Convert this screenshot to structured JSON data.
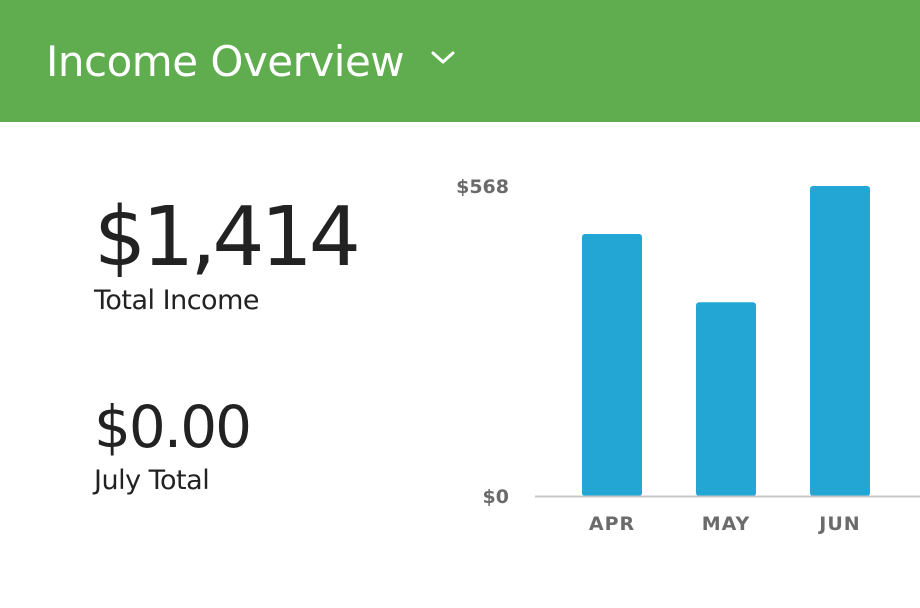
{
  "header": {
    "title": "Income Overview"
  },
  "stats": {
    "total_value": "$1,414",
    "total_label": "Total Income",
    "month_value": "$0.00",
    "month_label": "July Total"
  },
  "colors": {
    "header_bg": "#5fad4e",
    "bar": "#24a6d4",
    "axis": "#c8c8c8",
    "axis_text": "#6b6b6b"
  },
  "chart_data": {
    "type": "bar",
    "categories": [
      "APR",
      "MAY",
      "JUN"
    ],
    "values": [
      480,
      355,
      568
    ],
    "ylim": [
      0,
      568
    ],
    "y_tick_labels": [
      "$0",
      "$568"
    ],
    "grid": false,
    "legend": "none"
  }
}
